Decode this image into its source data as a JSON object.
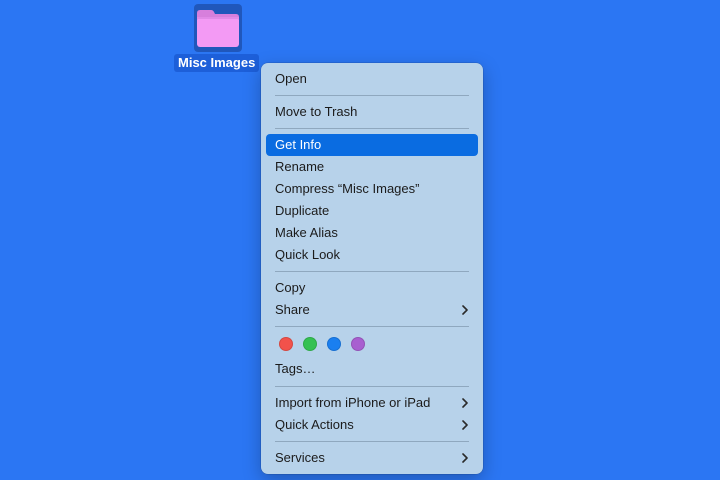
{
  "desktop": {
    "folder_label": "Misc Images",
    "folder_color": "#f39af4"
  },
  "menu": {
    "open": "Open",
    "move_to_trash": "Move to Trash",
    "get_info": "Get Info",
    "rename": "Rename",
    "compress": "Compress “Misc Images”",
    "duplicate": "Duplicate",
    "make_alias": "Make Alias",
    "quick_look": "Quick Look",
    "copy": "Copy",
    "share": "Share",
    "tags": "Tags…",
    "import_from": "Import from iPhone or iPad",
    "quick_actions": "Quick Actions",
    "services": "Services",
    "highlight_color": "#0a6ce1",
    "tag_colors": [
      {
        "name": "red",
        "color": "#f2524b"
      },
      {
        "name": "green",
        "color": "#35c153"
      },
      {
        "name": "blue",
        "color": "#1a7ff0"
      },
      {
        "name": "purple",
        "color": "#a85fd0"
      }
    ]
  }
}
